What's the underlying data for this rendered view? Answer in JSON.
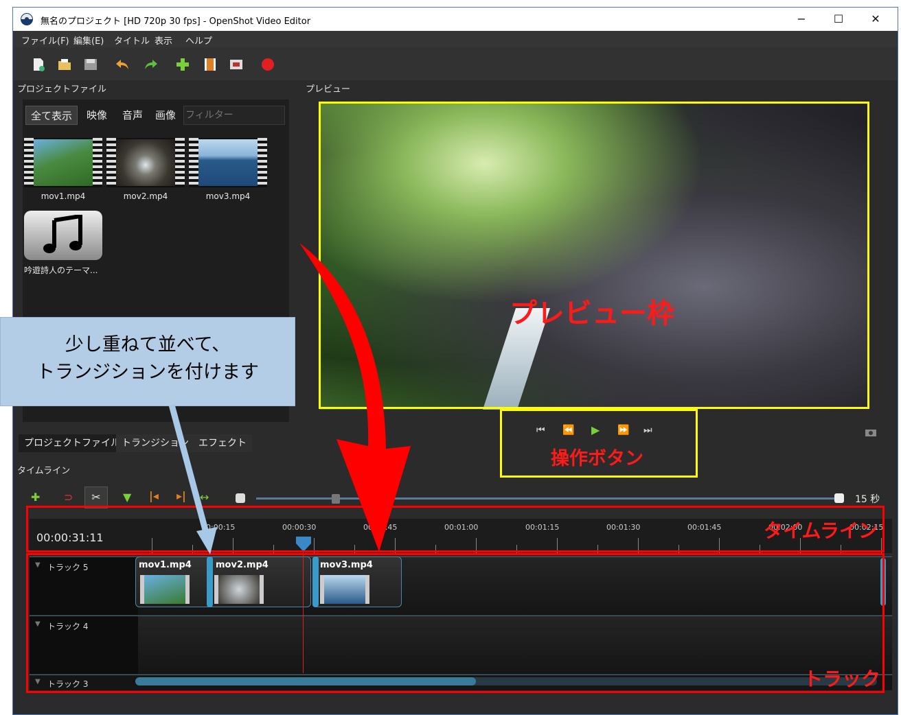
{
  "window": {
    "title": "無名のプロジェクト [HD 720p 30 fps] - OpenShot Video Editor",
    "minimize": "−",
    "maximize": "☐",
    "close": "✕"
  },
  "menu": [
    "ファイル(F)",
    "編集(E)",
    "タイトル",
    "表示",
    "ヘルプ"
  ],
  "project_files": {
    "title": "プロジェクトファイル",
    "filters": [
      "全て表示",
      "映像",
      "音声",
      "画像"
    ],
    "filter_placeholder": "フィルター",
    "files": [
      "mov1.mp4",
      "mov2.mp4",
      "mov3.mp4",
      "吟遊詩人のテーマ..."
    ]
  },
  "preview": {
    "title": "プレビュー"
  },
  "bottom_tabs": [
    "プロジェクトファイル",
    "トランジション",
    "エフェクト"
  ],
  "timeline": {
    "title": "タイムライン",
    "zoom_label": "15 秒",
    "current_time": "00:00:31:11",
    "ruler_labels": [
      "00:00:15",
      "00:00:30",
      "00:00:45",
      "00:01:00",
      "00:01:15",
      "00:01:30",
      "00:01:45",
      "00:02:00",
      "00:02:15"
    ],
    "tracks": [
      "トラック 5",
      "トラック 4",
      "トラック 3"
    ],
    "clips": [
      "mov1.mp4",
      "mov2.mp4",
      "mov3.mp4"
    ]
  },
  "annotations": {
    "callout_line1": "少し重ねて並べて、",
    "callout_line2": "トランジションを付けます",
    "preview_frame": "プレビュー枠",
    "controls": "操作ボタン",
    "timeline": "タイムライン",
    "track": "トラック"
  },
  "colors": {
    "annotation_red": "#ff0000",
    "annotation_yellow": "#ffff00",
    "callout_bg": "#b4cde6",
    "clip_border": "#4a88a8"
  }
}
